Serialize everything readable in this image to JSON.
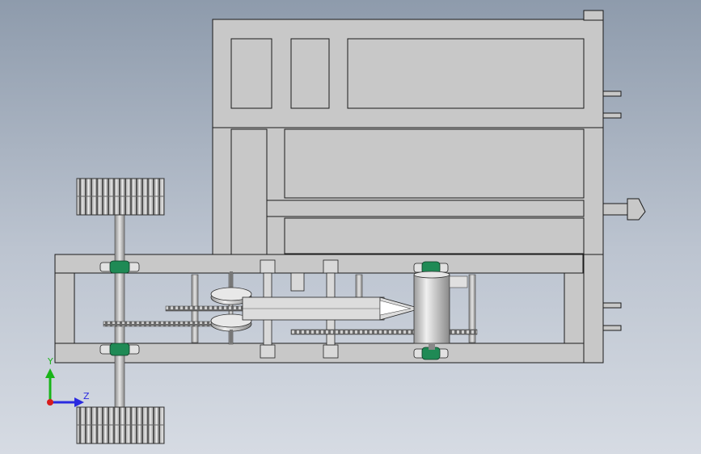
{
  "triad": {
    "y_label": "Y",
    "z_label": "Z",
    "y_color": "#19b419",
    "z_color": "#2a2ae0",
    "origin_color": "#d81c1c"
  },
  "model": {
    "frame_color": "#c8c8c8",
    "edge_color": "#1a1a1a",
    "bearing_color": "#1f8a55"
  }
}
